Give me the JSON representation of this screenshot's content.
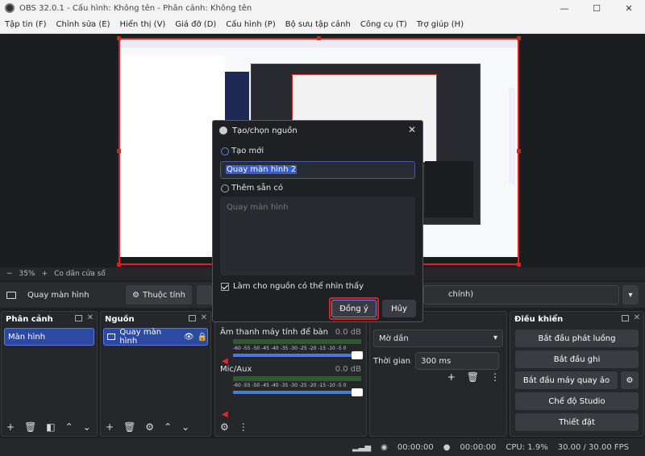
{
  "window": {
    "title": "OBS 32.0.1 - Cấu hình: Không tên - Phân cảnh: Không tên"
  },
  "menu": [
    "Tập tin (F)",
    "Chỉnh sửa (E)",
    "Hiển thị (V)",
    "Giá đỡ (D)",
    "Cấu hình (P)",
    "Bộ sưu tập cảnh",
    "Công cụ (T)",
    "Trợ giúp (H)"
  ],
  "zoom": {
    "minus": "−",
    "value": "35%",
    "plus": "+",
    "fit": "Co dãn cửa sổ"
  },
  "source_bar": {
    "source_name": "Quay màn hình",
    "properties": "Thuộc tính",
    "filter_tail": "chính)"
  },
  "scenes": {
    "title": "Phân cảnh",
    "items": [
      "Màn hình"
    ]
  },
  "sources": {
    "title": "Nguồn",
    "items": [
      "Quay màn hình"
    ]
  },
  "mixer": {
    "tracks": [
      {
        "name": "Âm thanh máy tính để bàn",
        "db": "0.0 dB"
      },
      {
        "name": "Mic/Aux",
        "db": "0.0 dB"
      }
    ],
    "scale": "-60 -55 -50 -45 -40 -35 -30 -25 -20 -15 -10 -5 0"
  },
  "transition": {
    "type": "Mờ dần",
    "duration_label": "Thời gian",
    "duration": "300 ms"
  },
  "controls": {
    "title": "Điều khiển",
    "buttons": [
      "Bắt đầu phát luồng",
      "Bắt đầu ghi",
      "Bắt đầu máy quay ảo",
      "Chế độ Studio",
      "Thiết đặt"
    ]
  },
  "status": {
    "stream_time": "00:00:00",
    "rec_time": "00:00:00",
    "cpu": "CPU: 1.9%",
    "fps": "30.00 / 30.00 FPS"
  },
  "dialog": {
    "title": "Tạo/chọn nguồn",
    "create_new": "Tạo mới",
    "name_value": "Quay màn hình 2",
    "add_existing": "Thêm sẵn có",
    "existing_item": "Quay màn hình",
    "visible_label": "Làm cho nguồn có thể nhìn thấy",
    "ok": "Đồng ý",
    "cancel": "Hủy"
  }
}
